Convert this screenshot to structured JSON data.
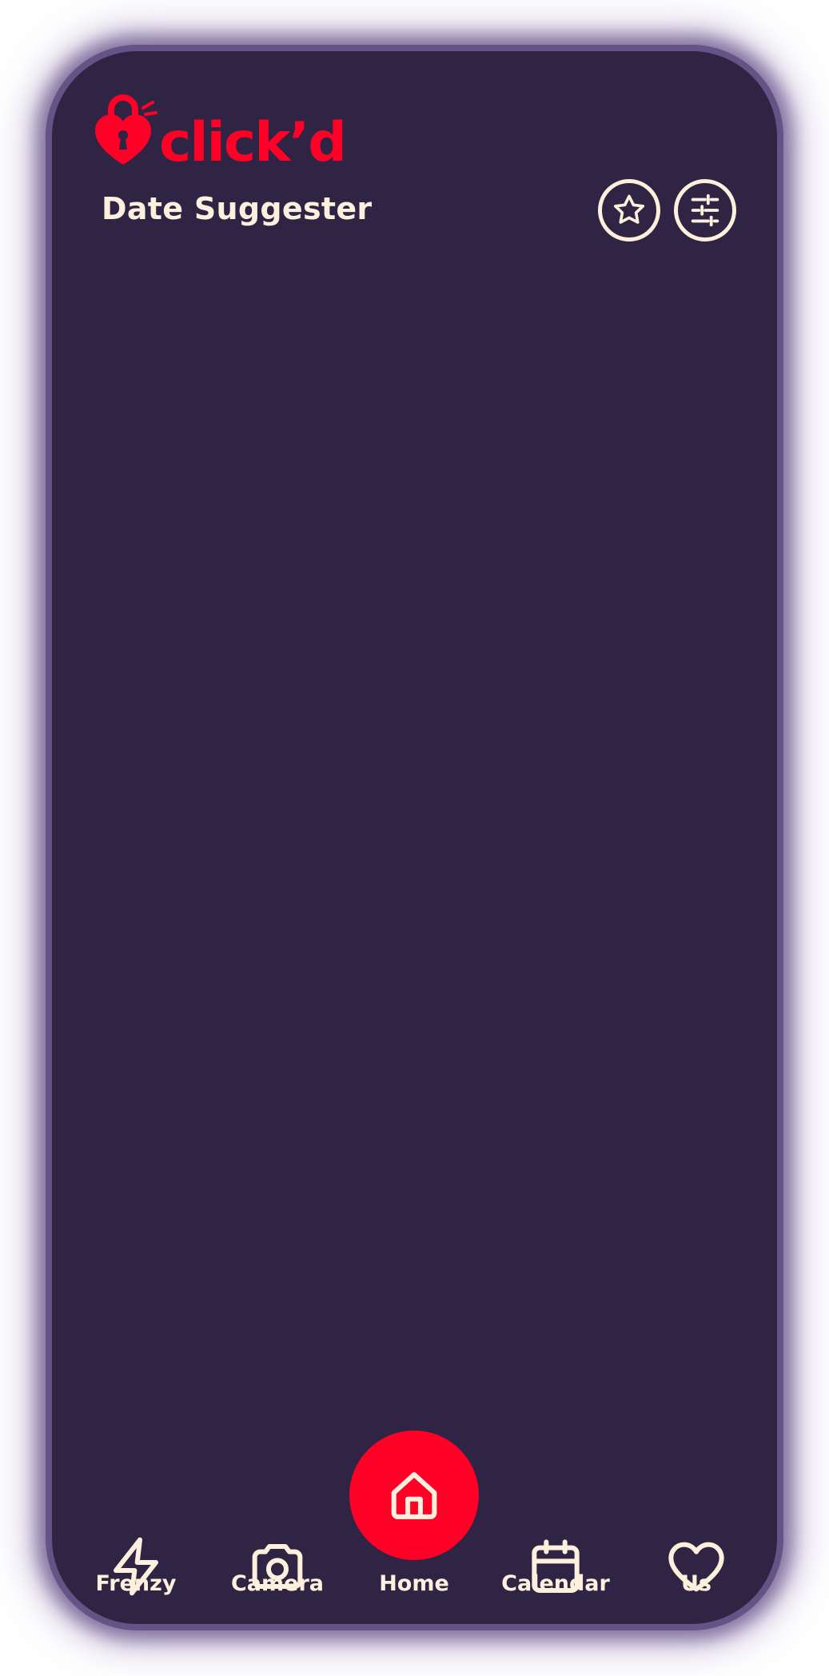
{
  "brand": {
    "name": "click'd",
    "logo_icon": "heart-padlock-icon",
    "color": "#ff0026"
  },
  "header": {
    "title": "Date Suggester",
    "favorites_icon": "star-icon",
    "filters_icon": "sliders-icon"
  },
  "theme": {
    "background": "#302444",
    "frame": "#655287",
    "foreground": "#fdf0dc",
    "accent": "#ff0026"
  },
  "nav": {
    "items": [
      {
        "label": "Frenzy",
        "icon": "lightning-bolt-icon"
      },
      {
        "label": "Camera",
        "icon": "camera-icon"
      },
      {
        "label": "Home",
        "icon": "home-icon",
        "active": true
      },
      {
        "label": "Calendar",
        "icon": "calendar-icon"
      },
      {
        "label": "Us",
        "icon": "heart-icon"
      }
    ]
  }
}
